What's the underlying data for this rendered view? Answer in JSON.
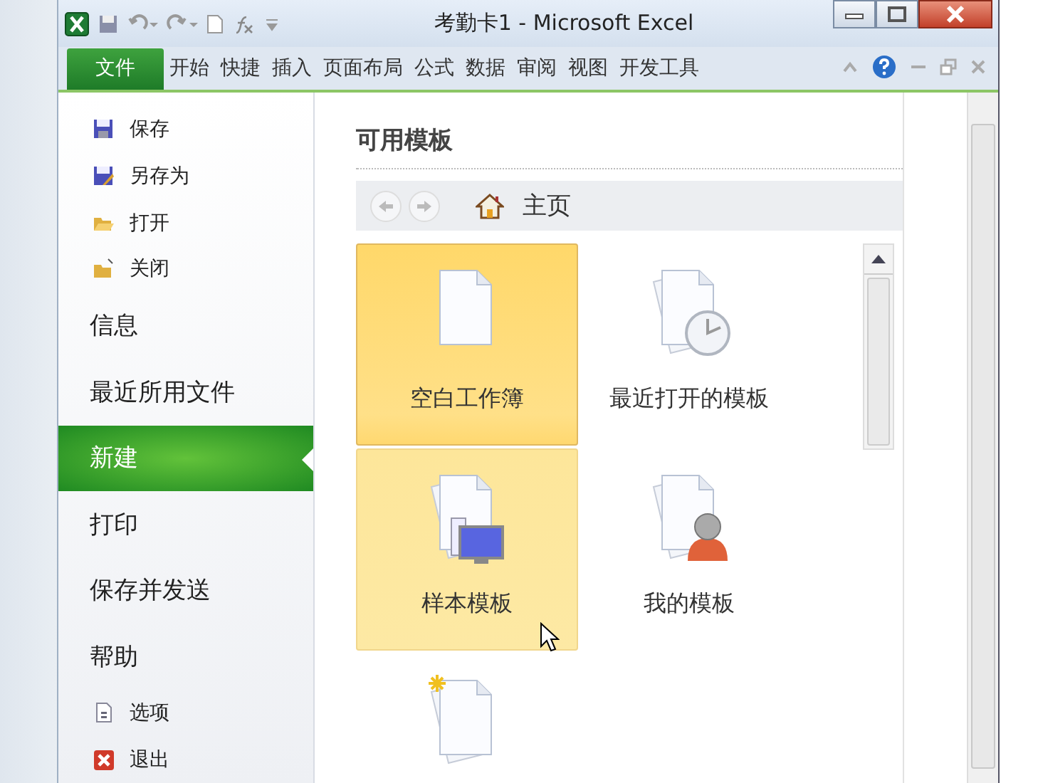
{
  "window": {
    "title": "考勤卡1 - Microsoft Excel"
  },
  "ribbon_tabs": [
    {
      "label": "文件",
      "selected": true
    },
    {
      "label": "开始",
      "selected": false
    },
    {
      "label": "快捷",
      "selected": false
    },
    {
      "label": "插入",
      "selected": false
    },
    {
      "label": "页面布局",
      "selected": false
    },
    {
      "label": "公式",
      "selected": false
    },
    {
      "label": "数据",
      "selected": false
    },
    {
      "label": "审阅",
      "selected": false
    },
    {
      "label": "视图",
      "selected": false
    },
    {
      "label": "开发工具",
      "selected": false
    }
  ],
  "sidebar": {
    "items": [
      {
        "label": "保存",
        "kind": "command",
        "selected": false
      },
      {
        "label": "另存为",
        "kind": "command",
        "selected": false
      },
      {
        "label": "打开",
        "kind": "command",
        "selected": false
      },
      {
        "label": "关闭",
        "kind": "command",
        "selected": false
      },
      {
        "label": "信息",
        "kind": "section",
        "selected": false
      },
      {
        "label": "最近所用文件",
        "kind": "section",
        "selected": false
      },
      {
        "label": "新建",
        "kind": "section",
        "selected": true
      },
      {
        "label": "打印",
        "kind": "section",
        "selected": false
      },
      {
        "label": "保存并发送",
        "kind": "section",
        "selected": false
      },
      {
        "label": "帮助",
        "kind": "section",
        "selected": false
      },
      {
        "label": "选项",
        "kind": "command",
        "selected": false
      },
      {
        "label": "退出",
        "kind": "command",
        "selected": false
      }
    ]
  },
  "main": {
    "heading": "可用模板",
    "breadcrumb": "主页",
    "templates": [
      {
        "label": "空白工作簿",
        "selected": true,
        "hovered": false
      },
      {
        "label": "最近打开的模板",
        "selected": false,
        "hovered": false
      },
      {
        "label": "样本模板",
        "selected": false,
        "hovered": true
      },
      {
        "label": "我的模板",
        "selected": false,
        "hovered": false
      },
      {
        "selected": false,
        "hovered": false
      }
    ]
  }
}
